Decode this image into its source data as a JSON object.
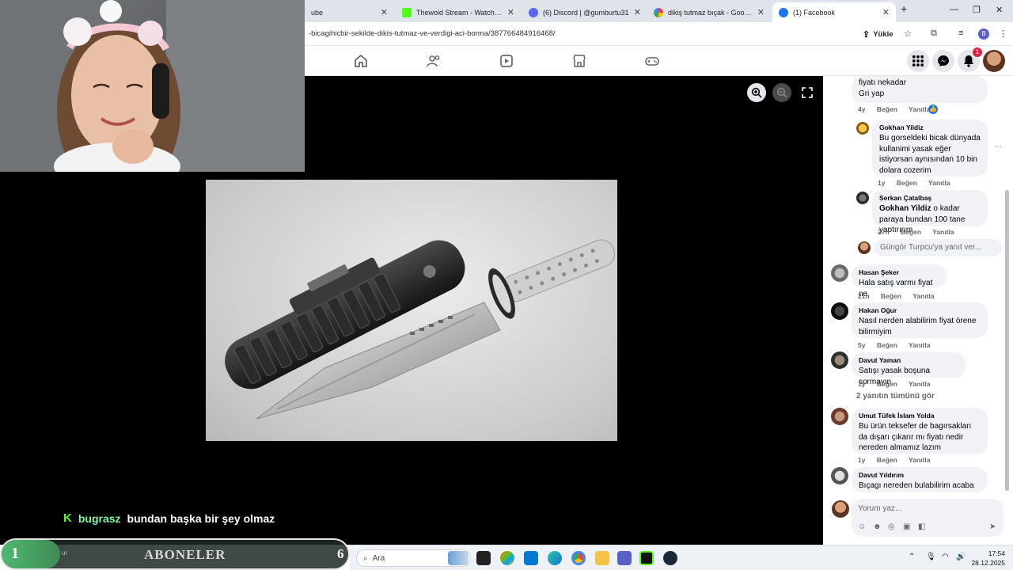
{
  "browser": {
    "tabs": [
      {
        "title": "ube",
        "color": "#ff0000",
        "active": false
      },
      {
        "title": "Thewoid Stream - Watch Live o",
        "color": "#53fc18",
        "active": false
      },
      {
        "title": "(6) Discord | @gumburtu31",
        "color": "#5865f2",
        "active": false
      },
      {
        "title": "dikiş tutmaz bıçak - Google'da",
        "color": "#4285f4",
        "active": false
      },
      {
        "title": "(1) Facebook",
        "color": "#1877f2",
        "active": true
      }
    ],
    "new_tab": "+",
    "url": "-bicagihicbir-sekilde-dikis-tutmaz-ve-verdigi-aci-borma/387766484916468/",
    "install_label": "Yükle",
    "profile_initial": "B"
  },
  "fbnav": {
    "notification_count": "1"
  },
  "stream": {
    "chat": {
      "username": "bugrasz",
      "message": "bundan başka bir şey olmaz"
    },
    "subscriber_goal": {
      "current": "1",
      "label": "ABONELER",
      "goal": "6",
      "progress": 0.17,
      "tiny_text": "ur"
    }
  },
  "comments": [
    {
      "name": "",
      "text": "fiyatı nekadar\nGri yap",
      "time": "4y",
      "like": "Beğen",
      "reply": "Yanıtla"
    },
    {
      "name": "Gokhan Yildiz",
      "text": "Bu gorseldeki bicak dünyada kullanimi yasak eğer istiyorsan aynısından 10 bin dolara cozerim",
      "time": "1y",
      "like": "Beğen",
      "reply": "Yanıtla"
    },
    {
      "name": "Serkan Çatalbaş",
      "mention": "Gokhan Yildiz",
      "text": " o kadar paraya bundan 100 tane yaptırırım",
      "time": "27h",
      "like": "Beğen",
      "reply": "Yanıtla"
    },
    {
      "name": "Hasan Şeker",
      "text": "Hala satış varmı fiyat ne",
      "time": "21h",
      "like": "Beğen",
      "reply": "Yanıtla"
    },
    {
      "name": "Hakan Oğur",
      "text": "Nasıl nerden alabilirim fiyat örene bilirmiyim",
      "time": "5y",
      "like": "Beğen",
      "reply": "Yanıtla"
    },
    {
      "name": "Davut Yaman",
      "text": "Satışı yasak boşuna sormayın",
      "time": "1y",
      "like": "Beğen",
      "reply": "Yanıtla"
    },
    {
      "name": "Umut Tüfek İslam Yolda",
      "text": "Bu ürün teksefer de bagırsakları da dışarı çıkarır mı fiyatı nedir nereden almamız lazım",
      "time": "1y",
      "like": "Beğen",
      "reply": "Yanıtla"
    },
    {
      "name": "Davut Yıldırım",
      "text": "Bıçagı nereden bulabilirim acaba",
      "time": "",
      "like": "",
      "reply": ""
    }
  ],
  "reply_placeholder": "Güngör Turpcu'ya yanıt ver...",
  "view_replies": "2 yanıtın tümünü gör",
  "write_placeholder": "Yorum yaz...",
  "taskbar": {
    "search_label": "Ara",
    "time": "17:54",
    "date": "28.12.2025"
  }
}
